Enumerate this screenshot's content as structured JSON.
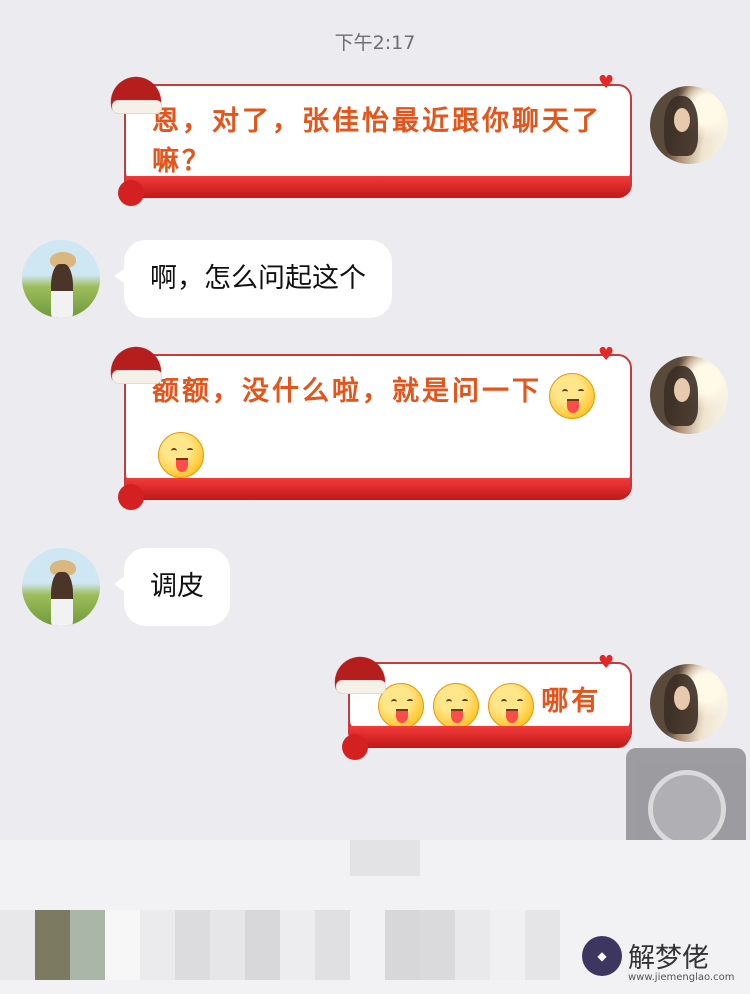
{
  "status": {
    "timestamp": "下午2:17"
  },
  "messages": [
    {
      "sender": "me",
      "style": "festive",
      "text": "恩，对了，张佳怡最近跟你聊天了嘛？",
      "line1": "恩，对了，张佳怡最近跟你聊天了",
      "line2": "嘛？"
    },
    {
      "sender": "friend",
      "style": "plain",
      "text": "啊，怎么问起这个"
    },
    {
      "sender": "me",
      "style": "festive",
      "text": "额额，没什么啦，就是问一下",
      "emojis": [
        "tongue-face-emoji",
        "tongue-face-emoji"
      ]
    },
    {
      "sender": "friend",
      "style": "plain",
      "text": "调皮"
    },
    {
      "sender": "me",
      "style": "festive",
      "text": "哪有",
      "emojis": [
        "tongue-face-emoji",
        "tongue-face-emoji",
        "tongue-face-emoji"
      ]
    }
  ],
  "watermark": {
    "title": "解梦佬",
    "url": "www.jiemenglao.com"
  },
  "colors": {
    "festive_text": "#e5541a",
    "ribbon": "#e13131",
    "background": "#ebebf0"
  }
}
